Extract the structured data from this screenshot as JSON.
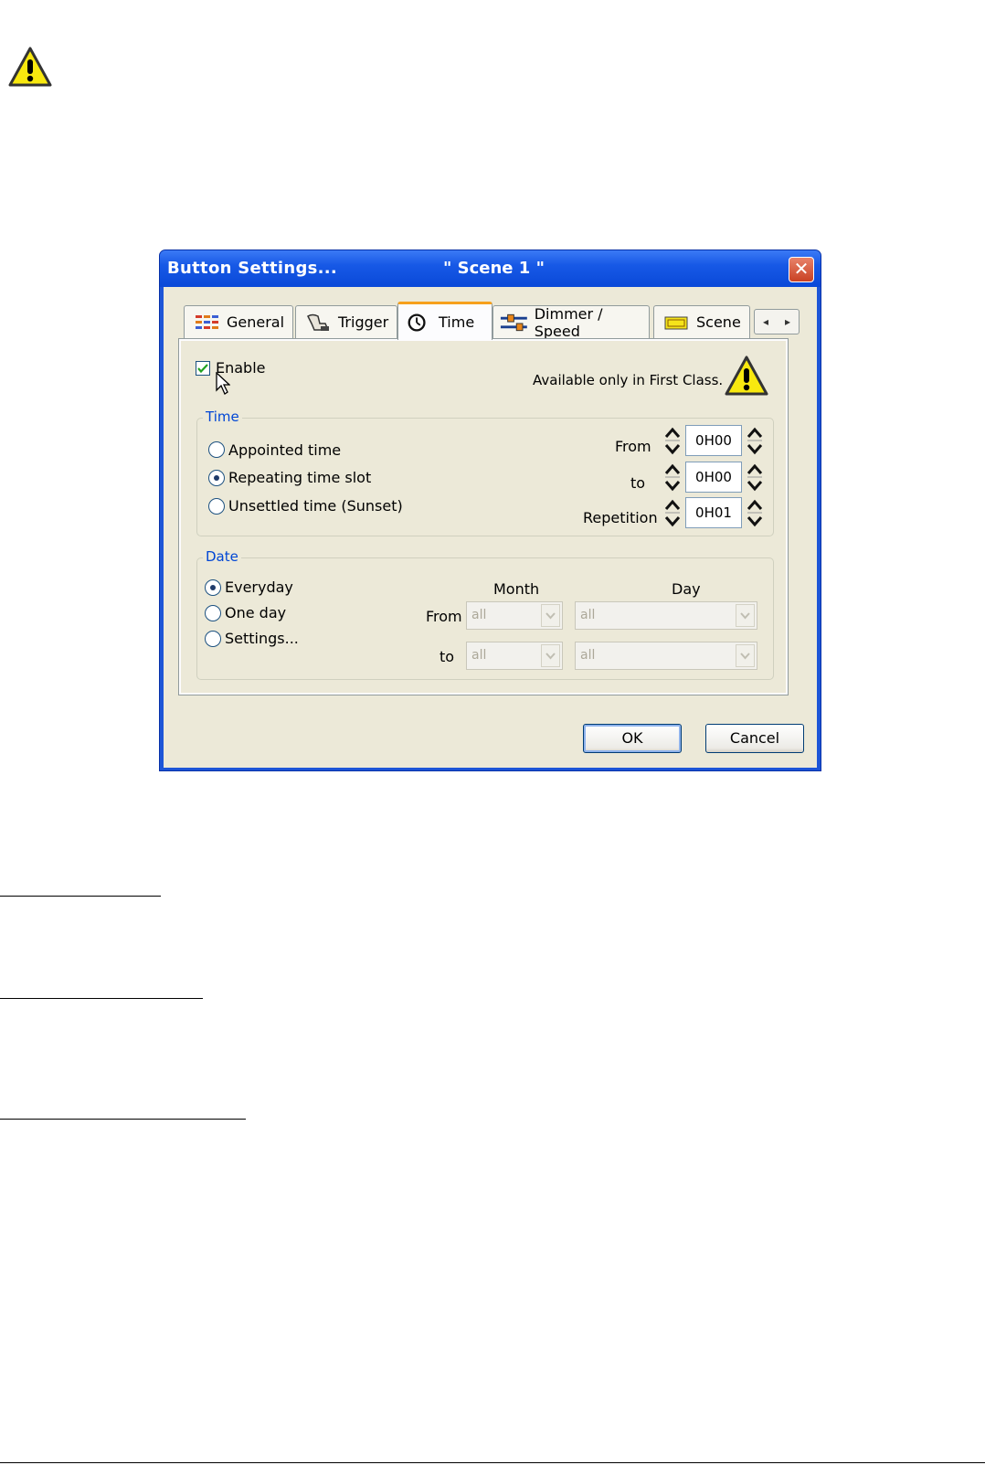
{
  "window": {
    "title": "Button  Settings...",
    "scene_title": "\" Scene 1 \"",
    "close_glyph": "✕"
  },
  "tabs": [
    {
      "label": "General",
      "icon": "grid-icon"
    },
    {
      "label": "Trigger",
      "icon": "hand-icon"
    },
    {
      "label": "Time",
      "icon": "clock-icon",
      "active": true
    },
    {
      "label": "Dimmer / Speed",
      "icon": "slider-icon"
    },
    {
      "label": "Scene",
      "icon": "scene-icon"
    }
  ],
  "tab_scroll": {
    "left": "◂",
    "right": "▸"
  },
  "enable": {
    "label": "Enable",
    "checked": true
  },
  "notice": {
    "text": "Available only in First Class."
  },
  "time_group": {
    "label": "Time",
    "options": [
      "Appointed time",
      "Repeating time slot",
      "Unsettled time (Sunset)"
    ],
    "selected": "Repeating time slot",
    "from_label": "From",
    "to_label": "to",
    "repetition_label": "Repetition",
    "from_value": "0H00",
    "to_value": "0H00",
    "repetition_value": "0H01"
  },
  "date_group": {
    "label": "Date",
    "options": [
      "Everyday",
      "One day",
      "Settings..."
    ],
    "selected": "Everyday",
    "month_header": "Month",
    "day_header": "Day",
    "from_label": "From",
    "to_label": "to",
    "from_month": "all",
    "from_day": "all",
    "to_month": "all",
    "to_day": "all"
  },
  "buttons": {
    "ok": "OK",
    "cancel": "Cancel"
  },
  "colors": {
    "title_bar": "#0a49d8",
    "active_tab_accent": "#f6a01c",
    "group_label": "#0046d5",
    "close": "#c94123"
  }
}
